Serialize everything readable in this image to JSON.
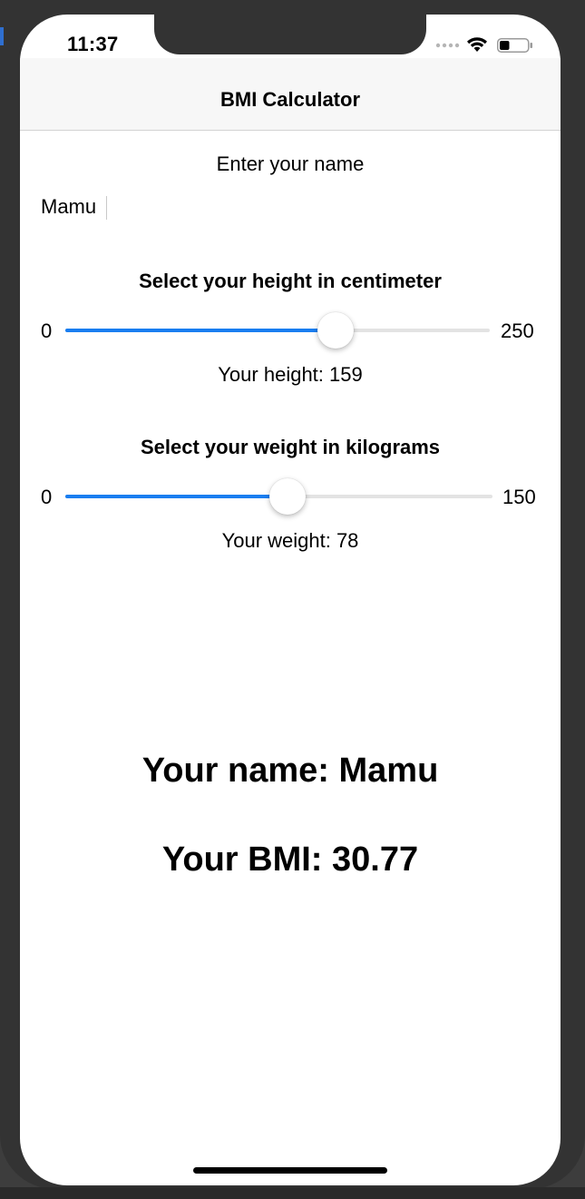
{
  "status_bar": {
    "time": "11:37",
    "icons": [
      "signal-icon",
      "wifi-icon",
      "battery-icon"
    ],
    "battery_level": 0.35
  },
  "navbar": {
    "title": "BMI Calculator"
  },
  "name_section": {
    "prompt": "Enter your name",
    "input_value": "Mamu"
  },
  "height_section": {
    "heading": "Select your height in centimeter",
    "min_label": "0",
    "max_label": "250",
    "min": 0,
    "max": 250,
    "value": 159,
    "readout": "Your height: 159"
  },
  "weight_section": {
    "heading": "Select your weight in kilograms",
    "min_label": "0",
    "max_label": "150",
    "min": 0,
    "max": 150,
    "value": 78,
    "readout": "Your weight: 78"
  },
  "results": {
    "name_line": "Your name: Mamu",
    "bmi_line": "Your BMI: 30.77"
  },
  "colors": {
    "accent": "#1a7ef0",
    "track": "#e3e3e3",
    "frame": "#333333"
  }
}
